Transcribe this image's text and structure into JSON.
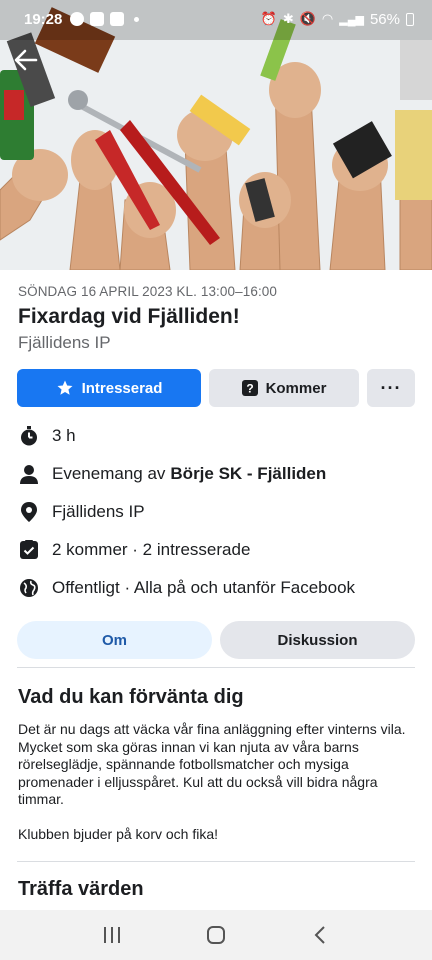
{
  "status": {
    "time": "19:28",
    "battery": "56%"
  },
  "event": {
    "date": "SÖNDAG 16 APRIL 2023 KL. 13:00–16:00",
    "title": "Fixardag vid Fjälliden!",
    "venue": "Fjällidens IP"
  },
  "actions": {
    "interested_label": "Intresserad",
    "going_label": "Kommer",
    "more_label": "···"
  },
  "info": {
    "duration": "3 h",
    "organizer_prefix": "Evenemang av",
    "organizer_name": "Börje SK - Fjälliden",
    "location": "Fjällidens IP",
    "attendance": "2 kommer · 2 intresserade",
    "privacy": "Offentligt · Alla på och utanför Facebook"
  },
  "tabs": {
    "about": "Om",
    "discussion": "Diskussion"
  },
  "about": {
    "heading": "Vad du kan förvänta dig",
    "paragraph1": "Det är nu dags att väcka vår fina anläggning efter vinterns vila. Mycket som ska göras innan vi kan njuta av våra barns rörelseglädje, spännande fotbollsmatcher och mysiga promenader i elljusspåret. Kul att du också vill bidra några timmar.",
    "paragraph2": "Klubben bjuder på korv och fika!"
  },
  "hosts": {
    "heading": "Träffa värden"
  },
  "colors": {
    "primary": "#1877f2",
    "tab_active_bg": "#e7f3ff",
    "tab_active_text": "#1f5aa8",
    "secondary_bg": "#e4e6eb"
  }
}
